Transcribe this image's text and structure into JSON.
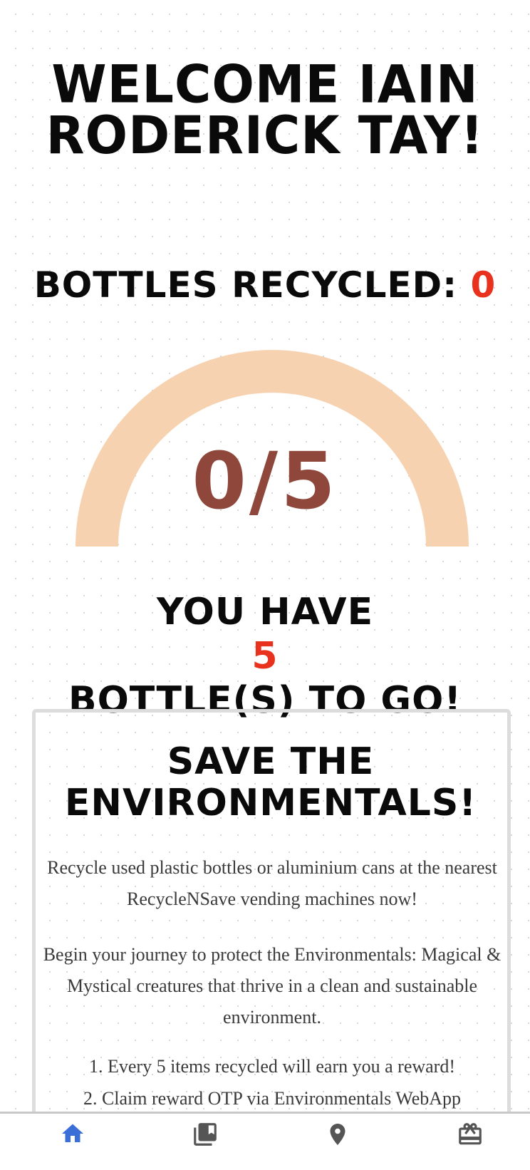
{
  "welcome": {
    "line1": "WELCOME IAIN",
    "line2": "RODERICK TAY!"
  },
  "bottles": {
    "label": "BOTTLES RECYCLED: ",
    "count": "0"
  },
  "gauge": {
    "current": 0,
    "goal": 5,
    "display": "0/5",
    "track_color": "#f6d2b0",
    "text_color": "#8f463b"
  },
  "progress_message": {
    "prefix": "YOU HAVE ",
    "remaining": "5",
    "line2": "BOTTLE(S) TO GO!"
  },
  "card": {
    "title_line1": "SAVE THE",
    "title_line2": "ENVIRONMENTALS!",
    "paragraph1": "Recycle used plastic bottles or aluminium cans at the nearest RecycleNSave vending machines now!",
    "paragraph2": "Begin your journey to protect the Environmentals: Magical & Mystical creatures that thrive in a clean and sustainable environment.",
    "steps": [
      "1. Every 5 items recycled will earn you a reward!",
      "2. Claim reward OTP via Environmentals WebApp"
    ]
  },
  "nav": {
    "items": [
      {
        "icon": "home-icon",
        "active": true
      },
      {
        "icon": "collection-icon",
        "active": false
      },
      {
        "icon": "location-pin-icon",
        "active": false
      },
      {
        "icon": "gift-icon",
        "active": false
      }
    ],
    "active_color": "#3a6fd8",
    "inactive_color": "#555555"
  },
  "colors": {
    "accent_red": "#e8321e",
    "text_dark": "#0a0a0a"
  }
}
